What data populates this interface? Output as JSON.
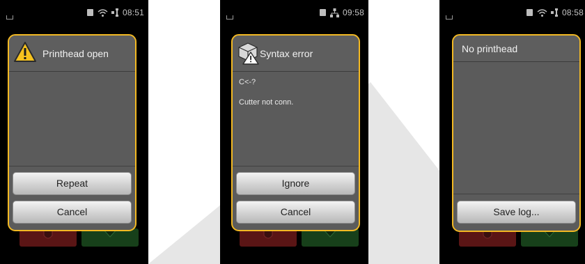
{
  "screens": [
    {
      "status": {
        "time": "08:51",
        "network_icon": "wifi-icon"
      },
      "dialog": {
        "title_icon": "warning-icon",
        "title": "Printhead open",
        "lines": [],
        "buttons": [
          "Repeat",
          "Cancel"
        ]
      }
    },
    {
      "status": {
        "time": "09:58",
        "network_icon": "ethernet-icon"
      },
      "dialog": {
        "title_icon": "syntax-error-icon",
        "title": "Syntax error",
        "lines": [
          "C<-?",
          "Cutter not conn."
        ],
        "buttons": [
          "Ignore",
          "Cancel"
        ]
      }
    },
    {
      "status": {
        "time": "08:58",
        "network_icon": "wifi-icon"
      },
      "dialog": {
        "title_icon": "",
        "title": "No printhead",
        "lines": [],
        "buttons": [
          "Save log..."
        ]
      }
    }
  ],
  "colors": {
    "dialog_border": "#f3b923",
    "dialog_bg": "#5b5b5b",
    "screen_bg": "#000000",
    "pause_button": "#5a1515",
    "feed_button": "#17401a",
    "backdrop_wedge": "#e6e6e6"
  }
}
